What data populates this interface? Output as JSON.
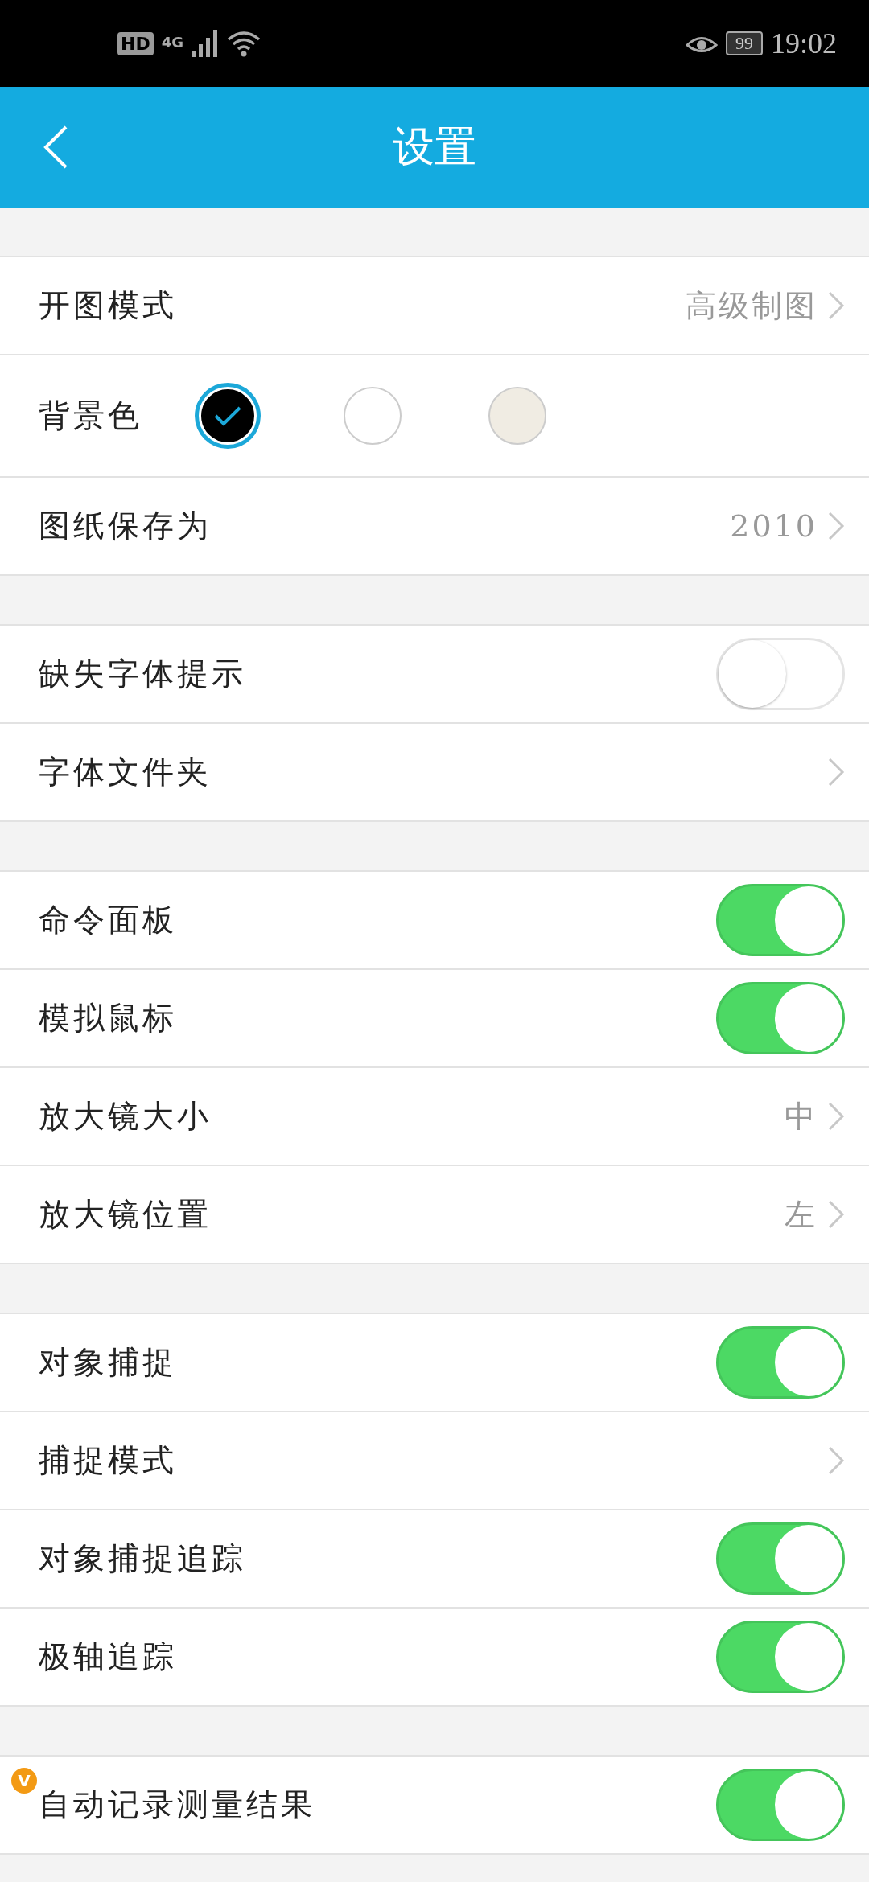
{
  "status_bar": {
    "hd": "HD",
    "network": "4G",
    "battery": "99",
    "time": "19:02"
  },
  "header": {
    "title": "设置"
  },
  "sections": [
    {
      "rows": [
        {
          "kind": "value",
          "label": "开图模式",
          "value": "高级制图"
        },
        {
          "kind": "colors",
          "label": "背景色",
          "colors": [
            {
              "color": "#000000",
              "selected": true
            },
            {
              "color": "#ffffff",
              "selected": false
            },
            {
              "color": "#f0ece3",
              "selected": false
            }
          ]
        },
        {
          "kind": "value",
          "label": "图纸保存为",
          "value": "2010"
        }
      ]
    },
    {
      "rows": [
        {
          "kind": "toggle",
          "label": "缺失字体提示",
          "on": false
        },
        {
          "kind": "link",
          "label": "字体文件夹"
        }
      ]
    },
    {
      "rows": [
        {
          "kind": "toggle",
          "label": "命令面板",
          "on": true
        },
        {
          "kind": "toggle",
          "label": "模拟鼠标",
          "on": true
        },
        {
          "kind": "value",
          "label": "放大镜大小",
          "value": "中"
        },
        {
          "kind": "value",
          "label": "放大镜位置",
          "value": "左"
        }
      ]
    },
    {
      "rows": [
        {
          "kind": "toggle",
          "label": "对象捕捉",
          "on": true
        },
        {
          "kind": "link",
          "label": "捕捉模式"
        },
        {
          "kind": "toggle",
          "label": "对象捕捉追踪",
          "on": true
        },
        {
          "kind": "toggle",
          "label": "极轴追踪",
          "on": true
        }
      ]
    },
    {
      "rows": [
        {
          "kind": "toggle",
          "label": "自动记录测量结果",
          "on": true,
          "badge": "V"
        }
      ]
    }
  ]
}
